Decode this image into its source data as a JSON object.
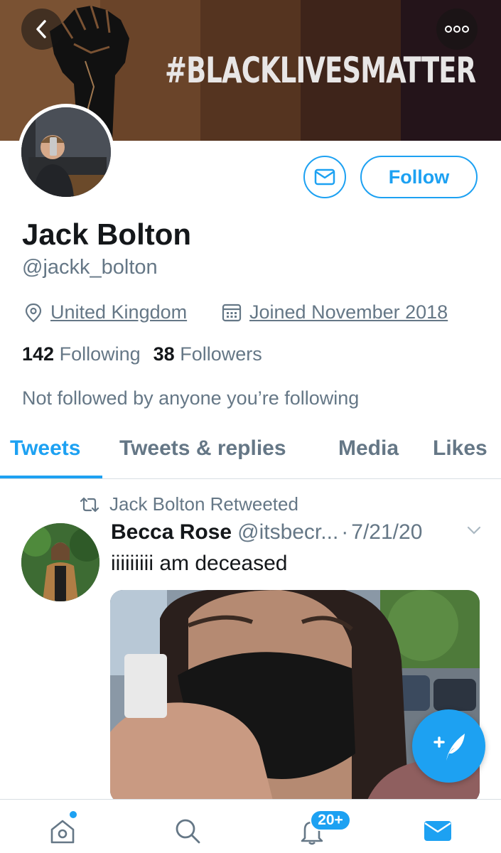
{
  "header": {
    "banner_text": "#BLACKLIVESMATTER",
    "back_icon": "chevron-left-icon",
    "more_icon": "more-horizontal-icon"
  },
  "profile": {
    "name": "Jack Bolton",
    "handle": "@jackk_bolton",
    "location": "United Kingdom",
    "joined": "Joined November 2018",
    "following_count": "142",
    "following_label": "Following",
    "followers_count": "38",
    "followers_label": "Followers",
    "not_followed_text": "Not followed by anyone you’re following",
    "follow_label": "Follow"
  },
  "tabs": [
    {
      "label": "Tweets",
      "active": true
    },
    {
      "label": "Tweets & replies",
      "active": false
    },
    {
      "label": "Media",
      "active": false
    },
    {
      "label": "Likes",
      "active": false
    }
  ],
  "tweet": {
    "retweet_text": "Jack Bolton Retweeted",
    "author": "Becca Rose",
    "handle": "@itsbecr...",
    "separator": "·",
    "date": "7/21/20",
    "text": "iiiiiiiii am deceased"
  },
  "nav": {
    "notification_badge": "20+"
  },
  "colors": {
    "accent": "#1da1f2",
    "secondary_text": "#657786",
    "primary_text": "#14171a"
  }
}
